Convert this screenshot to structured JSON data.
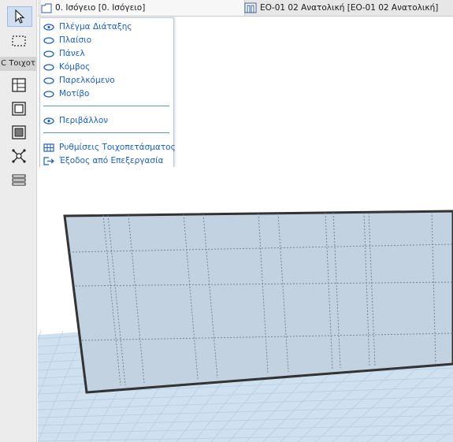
{
  "toolbox": {
    "label": "C Τοιχοτ",
    "tools": [
      {
        "name": "arrow-icon"
      },
      {
        "name": "marquee-icon"
      },
      {
        "name": "curtain-wall-grid-icon"
      },
      {
        "name": "frame-icon"
      },
      {
        "name": "panel-icon"
      },
      {
        "name": "junction-icon"
      },
      {
        "name": "accessory-icon"
      }
    ]
  },
  "tabs": [
    {
      "label": "0. Ισόγειο [0. Ισόγειο]",
      "icon": "floor-plan-icon"
    },
    {
      "label": "ΕΟ-01 02 Ανατολική [ΕΟ-01 02 Ανατολική]",
      "icon": "elevation-icon"
    }
  ],
  "menu": {
    "visibility_items": [
      {
        "label": "Πλέγμα Διάταξης"
      },
      {
        "label": "Πλαίσιο"
      },
      {
        "label": "Πάνελ"
      },
      {
        "label": "Κόμβος"
      },
      {
        "label": "Παρελκόμενο"
      },
      {
        "label": "Μοτίβο"
      }
    ],
    "environment_item": {
      "label": "Περιβάλλον"
    },
    "settings_item": {
      "label": "Ρυθμίσεις Τοιχοπετάσματος"
    },
    "exit_item": {
      "label": "Έξοδος από Επεξεργασία"
    }
  },
  "colors": {
    "menu_text": "#1f5fbf",
    "panel_fill": "#c2d2e0",
    "grid_floor": "#c9dcec"
  }
}
